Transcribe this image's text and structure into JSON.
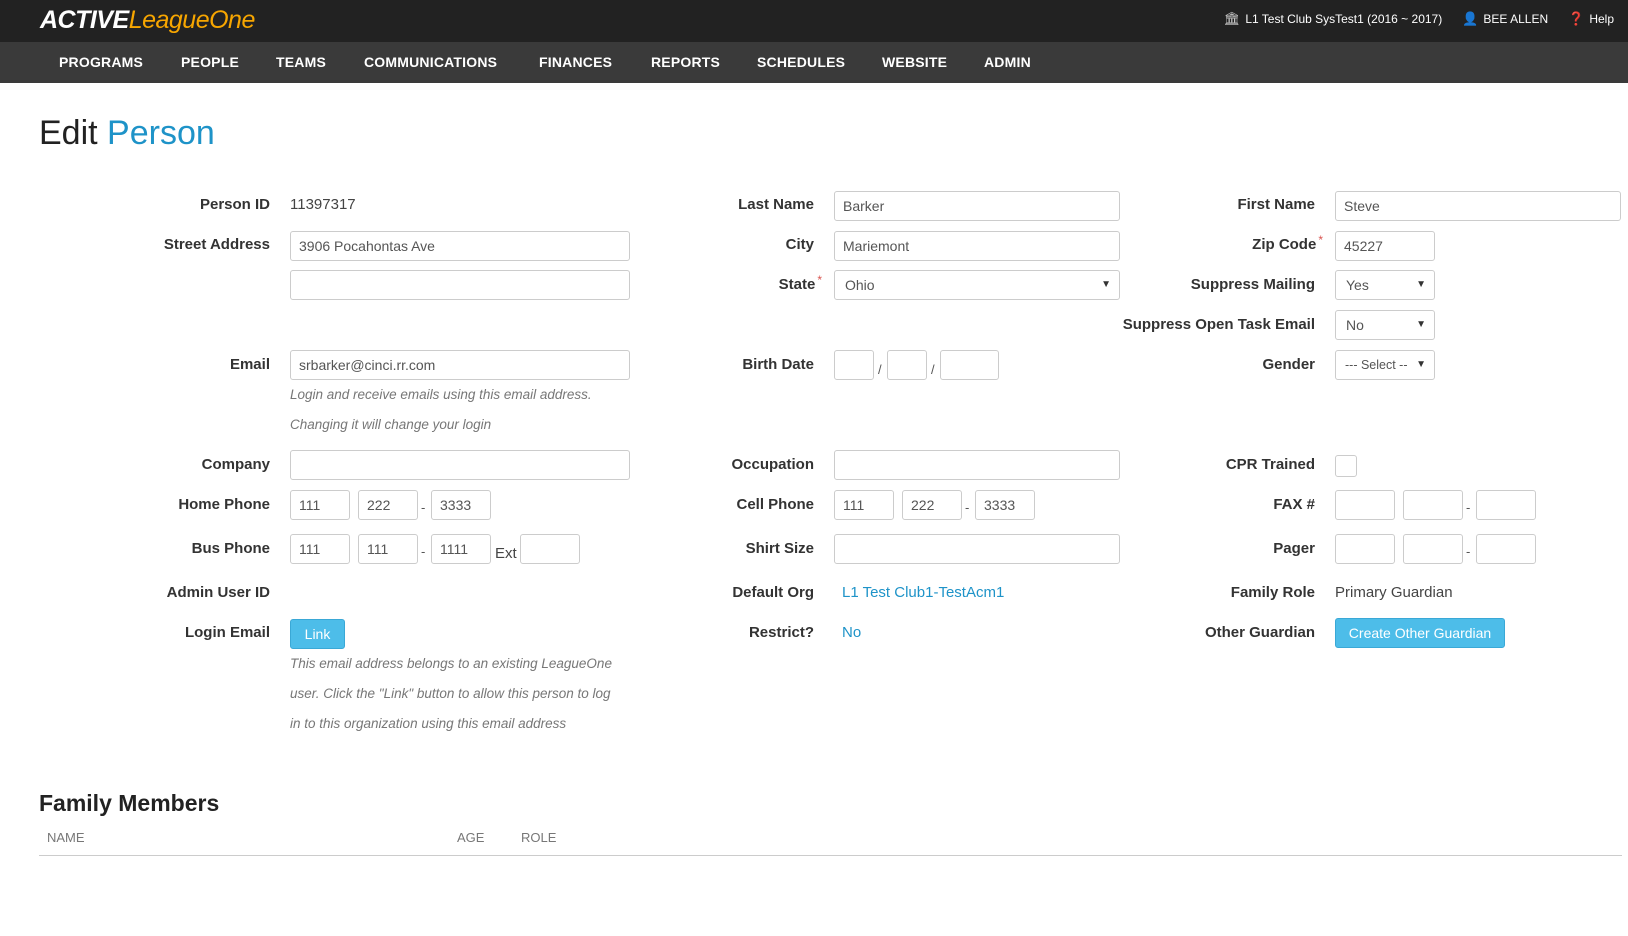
{
  "header": {
    "logo_part1": "ACTIVE",
    "logo_part2": "LeagueOne",
    "org": "L1 Test Club SysTest1 (2016 ~ 2017)",
    "user": "BEE ALLEN",
    "help": "Help"
  },
  "nav": [
    "PROGRAMS",
    "PEOPLE",
    "TEAMS",
    "COMMUNICATIONS",
    "FINANCES",
    "REPORTS",
    "SCHEDULES",
    "WEBSITE",
    "ADMIN"
  ],
  "page": {
    "title_part1": "Edit",
    "title_part2": "Person"
  },
  "labels": {
    "person_id": "Person ID",
    "street": "Street Address",
    "email": "Email",
    "company": "Company",
    "home_phone": "Home Phone",
    "bus_phone": "Bus Phone",
    "admin_user_id": "Admin User ID",
    "login_email": "Login Email",
    "last_name": "Last Name",
    "city": "City",
    "state": "State",
    "birth_date": "Birth Date",
    "occupation": "Occupation",
    "cell_phone": "Cell Phone",
    "shirt_size": "Shirt Size",
    "default_org": "Default Org",
    "restrict": "Restrict?",
    "first_name": "First Name",
    "zip": "Zip Code",
    "suppress_mailing": "Suppress Mailing",
    "suppress_task": "Suppress Open Task Email",
    "gender": "Gender",
    "cpr": "CPR Trained",
    "fax": "FAX #",
    "pager": "Pager",
    "family_role": "Family Role",
    "other_guardian": "Other Guardian",
    "ext": "Ext",
    "required": "*"
  },
  "values": {
    "person_id": "11397317",
    "street1": "3906 Pocahontas Ave",
    "street2": "",
    "email": "srbarker@cinci.rr.com",
    "company": "",
    "home_phone": [
      "111",
      "222",
      "3333"
    ],
    "bus_phone": [
      "111",
      "111",
      "1111"
    ],
    "bus_ext": "",
    "last_name": "Barker",
    "city": "Mariemont",
    "state": "Ohio",
    "birth": [
      "",
      "",
      ""
    ],
    "occupation": "",
    "cell_phone": [
      "111",
      "222",
      "3333"
    ],
    "shirt_size": "",
    "default_org": "L1 Test Club1-TestAcm1",
    "restrict": "No",
    "first_name": "Steve",
    "zip": "45227",
    "suppress_mailing": "Yes",
    "suppress_task": "No",
    "gender": "--- Select --",
    "fax": [
      "",
      "",
      ""
    ],
    "pager": [
      "",
      "",
      ""
    ],
    "family_role": "Primary Guardian"
  },
  "notes": {
    "email1": "Login and receive emails using this email address.",
    "email2": "Changing it will change your login",
    "link1": "This email address belongs to an existing LeagueOne",
    "link2": "user. Click the \"Link\" button to allow this person to log",
    "link3": "in to this organization using this email address"
  },
  "buttons": {
    "link": "Link",
    "create_guardian": "Create Other Guardian"
  },
  "family": {
    "title": "Family Members",
    "columns": [
      "NAME",
      "AGE",
      "ROLE"
    ]
  },
  "separators": {
    "dash": "-",
    "slash": "/"
  }
}
